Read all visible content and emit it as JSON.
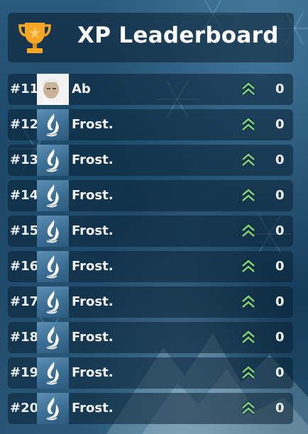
{
  "header": {
    "title": "XP Leaderboard",
    "icon": "trophy-icon"
  },
  "colors": {
    "trophy": "#f5a623",
    "level_chevron": "#7ed07a"
  },
  "rows": [
    {
      "rank": "#11",
      "name": "Ab",
      "avatar": "user-photo",
      "score": "0"
    },
    {
      "rank": "#12",
      "name": "Frost.",
      "avatar": "frost-logo-icon",
      "score": "0"
    },
    {
      "rank": "#13",
      "name": "Frost.",
      "avatar": "frost-logo-icon",
      "score": "0"
    },
    {
      "rank": "#14",
      "name": "Frost.",
      "avatar": "frost-logo-icon",
      "score": "0"
    },
    {
      "rank": "#15",
      "name": "Frost.",
      "avatar": "frost-logo-icon",
      "score": "0"
    },
    {
      "rank": "#16",
      "name": "Frost.",
      "avatar": "frost-logo-icon",
      "score": "0"
    },
    {
      "rank": "#17",
      "name": "Frost.",
      "avatar": "frost-logo-icon",
      "score": "0"
    },
    {
      "rank": "#18",
      "name": "Frost.",
      "avatar": "frost-logo-icon",
      "score": "0"
    },
    {
      "rank": "#19",
      "name": "Frost.",
      "avatar": "frost-logo-icon",
      "score": "0"
    },
    {
      "rank": "#20",
      "name": "Frost.",
      "avatar": "frost-logo-icon",
      "score": "0"
    }
  ]
}
